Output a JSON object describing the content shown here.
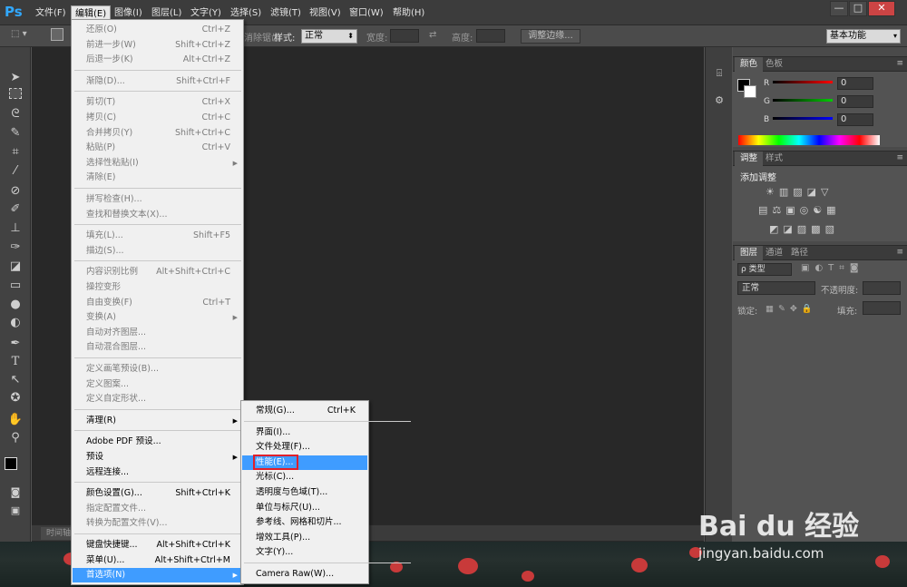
{
  "app": {
    "logo": "Ps"
  },
  "menubar": {
    "items": [
      "文件(F)",
      "编辑(E)",
      "图像(I)",
      "图层(L)",
      "文字(Y)",
      "选择(S)",
      "滤镜(T)",
      "视图(V)",
      "窗口(W)",
      "帮助(H)"
    ],
    "window_buttons": [
      "—",
      "□",
      "✕"
    ]
  },
  "options": {
    "style_label": "样式:",
    "style_value": "正常",
    "width_label": "宽度:",
    "height_label": "高度:",
    "refine_edge": "调整边缘...",
    "antialias": "消除锯齿",
    "workspace": "基本功能"
  },
  "edit_menu": {
    "groups": [
      [
        {
          "label": "还原(O)",
          "shortcut": "Ctrl+Z",
          "enabled": false
        },
        {
          "label": "前进一步(W)",
          "shortcut": "Shift+Ctrl+Z",
          "enabled": false
        },
        {
          "label": "后退一步(K)",
          "shortcut": "Alt+Ctrl+Z",
          "enabled": false
        }
      ],
      [
        {
          "label": "渐隐(D)...",
          "shortcut": "Shift+Ctrl+F",
          "enabled": false
        }
      ],
      [
        {
          "label": "剪切(T)",
          "shortcut": "Ctrl+X",
          "enabled": false
        },
        {
          "label": "拷贝(C)",
          "shortcut": "Ctrl+C",
          "enabled": false
        },
        {
          "label": "合并拷贝(Y)",
          "shortcut": "Shift+Ctrl+C",
          "enabled": false
        },
        {
          "label": "粘贴(P)",
          "shortcut": "Ctrl+V",
          "enabled": false
        },
        {
          "label": "选择性粘贴(I)",
          "shortcut": "",
          "enabled": false,
          "submenu": true
        },
        {
          "label": "清除(E)",
          "shortcut": "",
          "enabled": false
        }
      ],
      [
        {
          "label": "拼写检查(H)...",
          "shortcut": "",
          "enabled": false
        },
        {
          "label": "查找和替换文本(X)...",
          "shortcut": "",
          "enabled": false
        }
      ],
      [
        {
          "label": "填充(L)...",
          "shortcut": "Shift+F5",
          "enabled": false
        },
        {
          "label": "描边(S)...",
          "shortcut": "",
          "enabled": false
        }
      ],
      [
        {
          "label": "内容识别比例",
          "shortcut": "Alt+Shift+Ctrl+C",
          "enabled": false
        },
        {
          "label": "操控变形",
          "shortcut": "",
          "enabled": false
        },
        {
          "label": "自由变换(F)",
          "shortcut": "Ctrl+T",
          "enabled": false
        },
        {
          "label": "变换(A)",
          "shortcut": "",
          "enabled": false,
          "submenu": true
        },
        {
          "label": "自动对齐图层...",
          "shortcut": "",
          "enabled": false
        },
        {
          "label": "自动混合图层...",
          "shortcut": "",
          "enabled": false
        }
      ],
      [
        {
          "label": "定义画笔预设(B)...",
          "shortcut": "",
          "enabled": false
        },
        {
          "label": "定义图案...",
          "shortcut": "",
          "enabled": false
        },
        {
          "label": "定义自定形状...",
          "shortcut": "",
          "enabled": false
        }
      ],
      [
        {
          "label": "清理(R)",
          "shortcut": "",
          "enabled": true,
          "submenu": true
        }
      ],
      [
        {
          "label": "Adobe PDF 预设...",
          "shortcut": "",
          "enabled": true
        },
        {
          "label": "预设",
          "shortcut": "",
          "enabled": true,
          "submenu": true
        },
        {
          "label": "远程连接...",
          "shortcut": "",
          "enabled": true
        }
      ],
      [
        {
          "label": "颜色设置(G)...",
          "shortcut": "Shift+Ctrl+K",
          "enabled": true
        },
        {
          "label": "指定配置文件...",
          "shortcut": "",
          "enabled": false
        },
        {
          "label": "转换为配置文件(V)...",
          "shortcut": "",
          "enabled": false
        }
      ],
      [
        {
          "label": "键盘快捷键...",
          "shortcut": "Alt+Shift+Ctrl+K",
          "enabled": true
        },
        {
          "label": "菜单(U)...",
          "shortcut": "Alt+Shift+Ctrl+M",
          "enabled": true
        },
        {
          "label": "首选项(N)",
          "shortcut": "",
          "enabled": true,
          "submenu": true,
          "highlight": true
        }
      ]
    ]
  },
  "pref_menu": {
    "groups": [
      [
        {
          "label": "常规(G)...",
          "shortcut": "Ctrl+K"
        }
      ],
      [
        {
          "label": "界面(I)...",
          "shortcut": ""
        },
        {
          "label": "文件处理(F)...",
          "shortcut": ""
        },
        {
          "label": "性能(E)...",
          "shortcut": "",
          "highlight": true
        },
        {
          "label": "光标(C)...",
          "shortcut": ""
        },
        {
          "label": "透明度与色域(T)...",
          "shortcut": ""
        },
        {
          "label": "单位与标尺(U)...",
          "shortcut": ""
        },
        {
          "label": "参考线、网格和切片...",
          "shortcut": ""
        },
        {
          "label": "增效工具(P)...",
          "shortcut": ""
        },
        {
          "label": "文字(Y)...",
          "shortcut": ""
        }
      ],
      [
        {
          "label": "Camera Raw(W)...",
          "shortcut": ""
        }
      ]
    ]
  },
  "panels": {
    "color": {
      "tabs": [
        "颜色",
        "色板"
      ],
      "r_label": "R",
      "g_label": "G",
      "b_label": "B",
      "r": "0",
      "g": "0",
      "b": "0"
    },
    "adjust": {
      "tabs": [
        "调整",
        "样式"
      ],
      "title": "添加调整"
    },
    "layers": {
      "tabs": [
        "图层",
        "通道",
        "路径"
      ],
      "filter_label": "ρ 类型",
      "blend": "正常",
      "opacity_label": "不透明度:",
      "lock_label": "锁定:",
      "fill_label": "填充:"
    }
  },
  "timeline": {
    "label": "时间轴"
  },
  "watermark": {
    "logo": "Bai du 经验",
    "url": "jingyan.baidu.com"
  },
  "colors": {
    "menu_highlight": "#3f9cff",
    "red_box": "#e0202a",
    "ps_blue": "#31a8ff"
  }
}
